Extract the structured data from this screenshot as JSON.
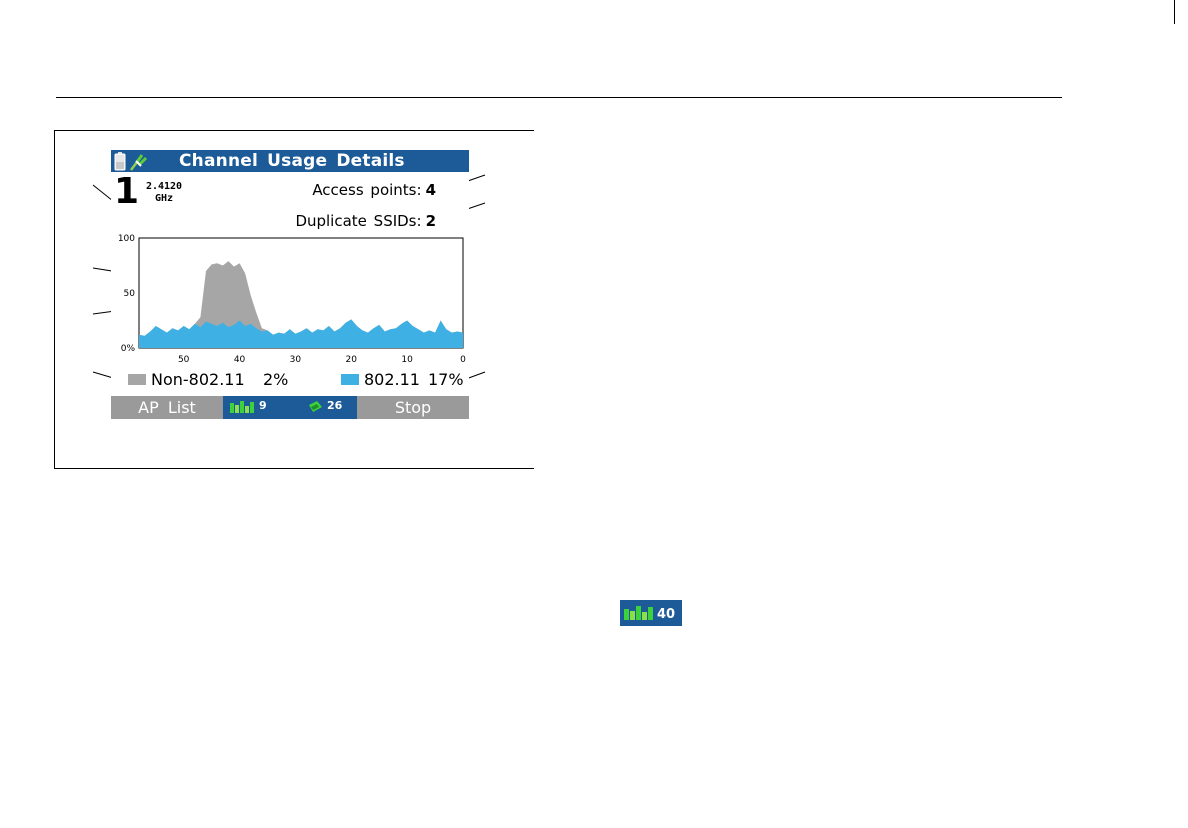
{
  "screen": {
    "title": "Channel Usage Details",
    "channel": {
      "number": "1",
      "frequency": "2.4120",
      "frequency_unit": "GHz"
    },
    "stats": {
      "access_points_label": "Access points:",
      "access_points_value": "4",
      "duplicate_ssids_label": "Duplicate SSIDs:",
      "duplicate_ssids_value": "2"
    },
    "legend": {
      "non_80211_label": "Non-802.11",
      "non_80211_value": "2%",
      "w80211_label": "802.11",
      "w80211_value": "17%"
    },
    "softkeys": {
      "left_label": "AP List",
      "ap_count": "9",
      "client_count": "26",
      "right_label": "Stop"
    }
  },
  "page_badge": {
    "ap_count": "40"
  },
  "colors": {
    "title_bar": "#1c5b98",
    "non_80211": "#a6a6a6",
    "w80211": "#3fb0e3",
    "softkey_bar": "#9a9a9a",
    "signal_green": "#3ed13e"
  },
  "chart_data": {
    "type": "area",
    "title": "",
    "xlabel": "",
    "ylabel": "",
    "x_reversed": true,
    "xlim": [
      58,
      0
    ],
    "ylim": [
      0,
      100
    ],
    "xticks": [
      "50",
      "40",
      "30",
      "20",
      "10",
      "0"
    ],
    "yticks": [
      "100",
      "50",
      "0%"
    ],
    "x": [
      58,
      57,
      56,
      55,
      54,
      53,
      52,
      51,
      50,
      49,
      48,
      47,
      46,
      45,
      44,
      43,
      42,
      41,
      40,
      39,
      38,
      37,
      36,
      35,
      34,
      33,
      32,
      31,
      30,
      29,
      28,
      27,
      26,
      25,
      24,
      23,
      22,
      21,
      20,
      19,
      18,
      17,
      16,
      15,
      14,
      13,
      12,
      11,
      10,
      9,
      8,
      7,
      6,
      5,
      4,
      3,
      2,
      1,
      0
    ],
    "series": [
      {
        "name": "Non-802.11",
        "values": [
          12,
          11,
          15,
          20,
          17,
          14,
          18,
          16,
          20,
          17,
          22,
          28,
          70,
          76,
          77,
          75,
          79,
          74,
          77,
          68,
          48,
          32,
          18,
          16,
          12,
          14,
          13,
          17,
          13,
          15,
          18,
          14,
          17,
          16,
          20,
          15,
          18,
          23,
          26,
          20,
          16,
          14,
          18,
          21,
          15,
          17,
          18,
          22,
          25,
          20,
          17,
          14,
          16,
          14,
          25,
          17,
          14,
          15,
          14
        ]
      },
      {
        "name": "802.11",
        "values": [
          12,
          11,
          15,
          20,
          17,
          14,
          18,
          16,
          20,
          17,
          22,
          19,
          24,
          22,
          20,
          23,
          19,
          21,
          25,
          20,
          22,
          18,
          15,
          16,
          12,
          14,
          13,
          17,
          13,
          15,
          18,
          14,
          17,
          16,
          20,
          15,
          18,
          23,
          26,
          20,
          16,
          14,
          18,
          21,
          15,
          17,
          18,
          22,
          25,
          20,
          17,
          14,
          16,
          14,
          25,
          17,
          14,
          15,
          14
        ]
      }
    ]
  }
}
